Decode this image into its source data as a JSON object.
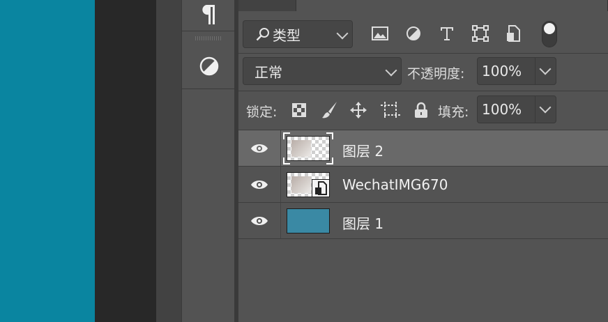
{
  "filter": {
    "kind_label": "类型"
  },
  "blend": {
    "mode": "正常",
    "opacity_label": "不透明度:",
    "opacity_value": "100%"
  },
  "lock": {
    "label": "锁定:",
    "fill_label": "填充:",
    "fill_value": "100%"
  },
  "layers": [
    {
      "name": "图层 2",
      "selected": true,
      "thumb": "checker"
    },
    {
      "name": "WechatIMG670",
      "selected": false,
      "thumb": "smart-object"
    },
    {
      "name": "图层 1",
      "selected": false,
      "thumb": "solid",
      "thumb_color": "#3a89a4"
    }
  ],
  "colors": {
    "canvas": "#0a85a0",
    "panel": "#535353",
    "selected_row": "#696969"
  }
}
